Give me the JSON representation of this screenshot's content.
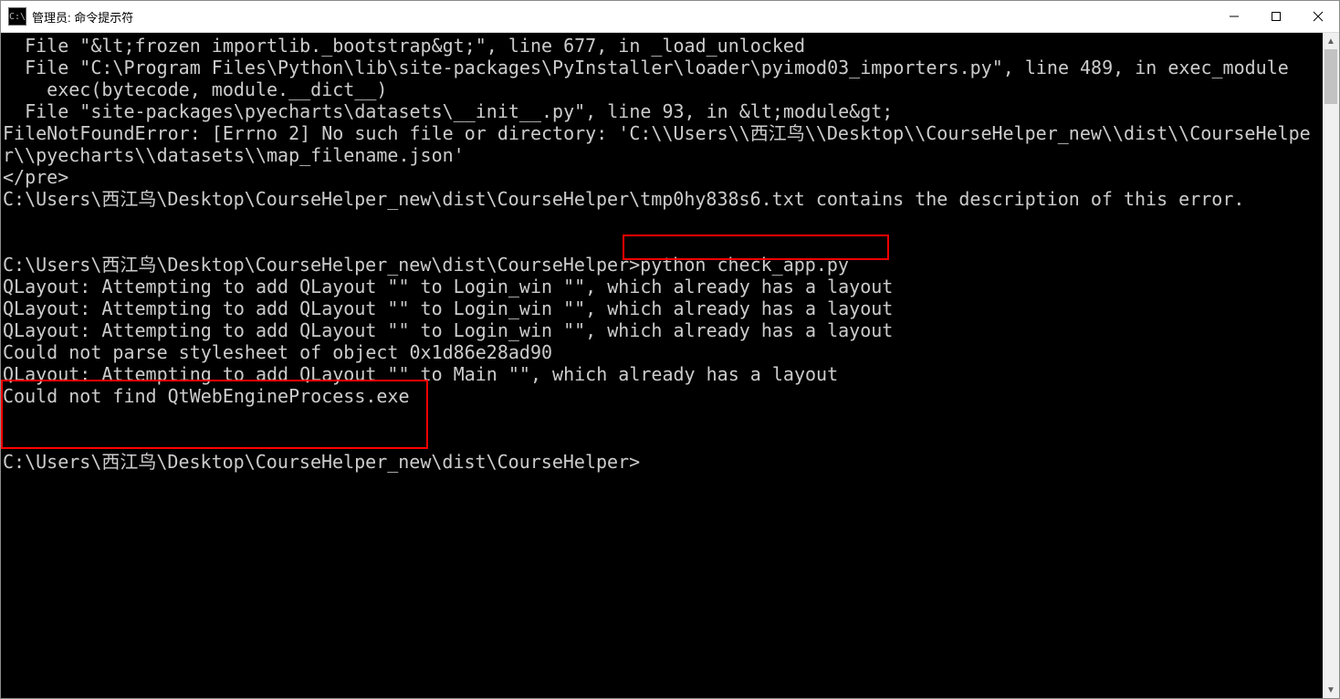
{
  "window": {
    "title": "管理员: 命令提示符"
  },
  "terminal": {
    "lines": [
      "  File \"&lt;frozen importlib._bootstrap&gt;\", line 677, in _load_unlocked",
      "  File \"C:\\Program Files\\Python\\lib\\site-packages\\PyInstaller\\loader\\pyimod03_importers.py\", line 489, in exec_module",
      "    exec(bytecode, module.__dict__)",
      "  File \"site-packages\\pyecharts\\datasets\\__init__.py\", line 93, in &lt;module&gt;",
      "FileNotFoundError: [Errno 2] No such file or directory: 'C:\\\\Users\\\\西江鸟\\\\Desktop\\\\CourseHelper_new\\\\dist\\\\CourseHelpe",
      "r\\\\pyecharts\\\\datasets\\\\map_filename.json'",
      "</pre>",
      "C:\\Users\\西江鸟\\Desktop\\CourseHelper_new\\dist\\CourseHelper\\tmp0hy838s6.txt contains the description of this error.",
      "",
      "",
      "C:\\Users\\西江鸟\\Desktop\\CourseHelper_new\\dist\\CourseHelper>python check_app.py",
      "QLayout: Attempting to add QLayout \"\" to Login_win \"\", which already has a layout",
      "QLayout: Attempting to add QLayout \"\" to Login_win \"\", which already has a layout",
      "QLayout: Attempting to add QLayout \"\" to Login_win \"\", which already has a layout",
      "Could not parse stylesheet of object 0x1d86e28ad90",
      "QLayout: Attempting to add QLayout \"\" to Main \"\", which already has a layout",
      "Could not find QtWebEngineProcess.exe",
      "",
      "",
      "C:\\Users\\西江鸟\\Desktop\\CourseHelper_new\\dist\\CourseHelper>"
    ]
  },
  "highlights": {
    "cmd_highlight": "python check_app.py",
    "error_highlight": "Could not find QtWebEngineProcess.exe"
  }
}
